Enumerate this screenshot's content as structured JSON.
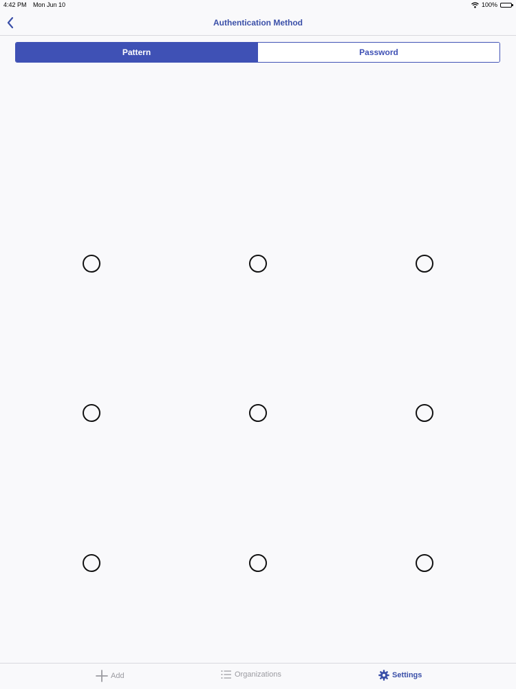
{
  "status_bar": {
    "time": "4:42 PM",
    "date": "Mon Jun 10",
    "battery": "100%",
    "wifi_icon": "wifi-icon",
    "battery_icon": "battery-icon"
  },
  "nav": {
    "title": "Authentication Method",
    "back_icon": "chevron-left-icon"
  },
  "segmented_control": {
    "options": [
      "Pattern",
      "Password"
    ],
    "selected": "Pattern"
  },
  "pattern_grid": {
    "rows": 3,
    "cols": 3,
    "selected_dots": []
  },
  "tab_bar": {
    "tabs": [
      {
        "label": "Add",
        "icon": "plus-icon",
        "active": false
      },
      {
        "label": "Organizations",
        "icon": "list-icon",
        "active": false
      },
      {
        "label": "Settings",
        "icon": "gear-icon",
        "active": true
      }
    ]
  },
  "colors": {
    "accent": "#3f51b5",
    "title": "#3a4fa8",
    "inactive_tab": "#9a9aa0",
    "background": "#f9f9fb"
  }
}
